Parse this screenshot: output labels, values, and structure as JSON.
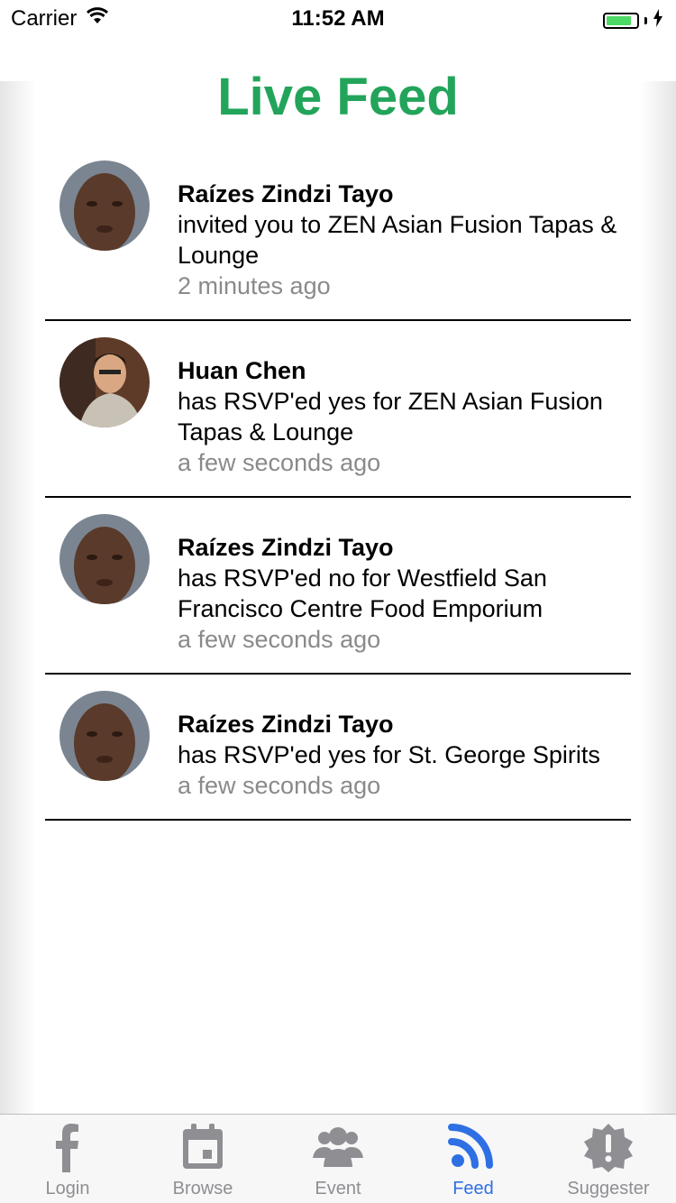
{
  "status_bar": {
    "carrier": "Carrier",
    "time": "11:52 AM",
    "battery_level": 0.85
  },
  "header": {
    "title": "Live Feed"
  },
  "feed": [
    {
      "name": "Raízes Zindzi Tayo",
      "message": " invited you to ZEN Asian Fusion Tapas & Lounge",
      "time": "2 minutes ago"
    },
    {
      "name": "Huan Chen",
      "message": " has RSVP'ed yes for ZEN Asian Fusion Tapas & Lounge",
      "time": "a few seconds ago"
    },
    {
      "name": "Raízes Zindzi Tayo",
      "message": " has RSVP'ed no for Westfield San Francisco Centre Food Emporium",
      "time": "a few seconds ago"
    },
    {
      "name": "Raízes Zindzi Tayo",
      "message": " has RSVP'ed yes for St. George Spirits",
      "time": "a few seconds ago"
    }
  ],
  "tab_bar": {
    "tabs": [
      {
        "label": "Login",
        "icon": "facebook-icon"
      },
      {
        "label": "Browse",
        "icon": "calendar-icon"
      },
      {
        "label": "Event",
        "icon": "users-icon"
      },
      {
        "label": "Feed",
        "icon": "rss-feed-icon"
      },
      {
        "label": "Suggester",
        "icon": "alert-badge-icon"
      }
    ],
    "active_color": "#2f6fe4",
    "inactive_color": "#8e8e93"
  },
  "colors": {
    "title": "#22a45a",
    "timestamp": "#8a8a8a"
  }
}
